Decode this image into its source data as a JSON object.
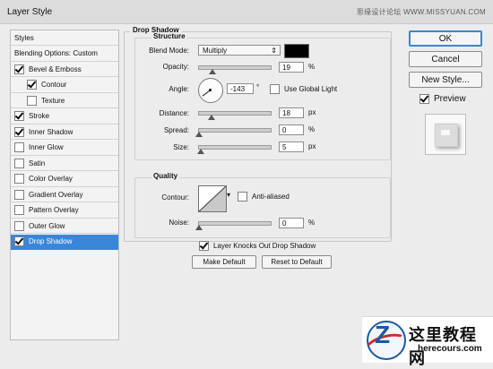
{
  "window": {
    "title": "Layer Style",
    "watermark": "思缘设计论坛 WWW.MISSYUAN.COM"
  },
  "left_panel": {
    "items": [
      {
        "label": "Styles",
        "checkbox": false,
        "checked": false,
        "indent": 0,
        "selected": false
      },
      {
        "label": "Blending Options: Custom",
        "checkbox": false,
        "checked": false,
        "indent": 0,
        "selected": false
      },
      {
        "label": "Bevel & Emboss",
        "checkbox": true,
        "checked": true,
        "indent": 0,
        "selected": false
      },
      {
        "label": "Contour",
        "checkbox": true,
        "checked": true,
        "indent": 1,
        "selected": false
      },
      {
        "label": "Texture",
        "checkbox": true,
        "checked": false,
        "indent": 1,
        "selected": false
      },
      {
        "label": "Stroke",
        "checkbox": true,
        "checked": true,
        "indent": 0,
        "selected": false
      },
      {
        "label": "Inner Shadow",
        "checkbox": true,
        "checked": true,
        "indent": 0,
        "selected": false
      },
      {
        "label": "Inner Glow",
        "checkbox": true,
        "checked": false,
        "indent": 0,
        "selected": false
      },
      {
        "label": "Satin",
        "checkbox": true,
        "checked": false,
        "indent": 0,
        "selected": false
      },
      {
        "label": "Color Overlay",
        "checkbox": true,
        "checked": false,
        "indent": 0,
        "selected": false
      },
      {
        "label": "Gradient Overlay",
        "checkbox": true,
        "checked": false,
        "indent": 0,
        "selected": false
      },
      {
        "label": "Pattern Overlay",
        "checkbox": true,
        "checked": false,
        "indent": 0,
        "selected": false
      },
      {
        "label": "Outer Glow",
        "checkbox": true,
        "checked": false,
        "indent": 0,
        "selected": false
      },
      {
        "label": "Drop Shadow",
        "checkbox": true,
        "checked": true,
        "indent": 0,
        "selected": true
      }
    ]
  },
  "drop_shadow": {
    "legend": "Drop Shadow",
    "structure": {
      "title": "Structure",
      "blend_mode_label": "Blend Mode:",
      "blend_mode_value": "Multiply",
      "color": "#000000",
      "opacity_label": "Opacity:",
      "opacity_value": "19",
      "opacity_unit": "%",
      "opacity_fraction": 0.19,
      "angle_label": "Angle:",
      "angle_value": "-143",
      "angle_unit": "°",
      "use_global_light_label": "Use Global Light",
      "use_global_light_checked": false,
      "distance_label": "Distance:",
      "distance_value": "18",
      "distance_unit": "px",
      "distance_fraction": 0.18,
      "spread_label": "Spread:",
      "spread_value": "0",
      "spread_unit": "%",
      "spread_fraction": 0.0,
      "size_label": "Size:",
      "size_value": "5",
      "size_unit": "px",
      "size_fraction": 0.03
    },
    "quality": {
      "title": "Quality",
      "contour_label": "Contour:",
      "anti_aliased_label": "Anti-aliased",
      "anti_aliased_checked": false,
      "noise_label": "Noise:",
      "noise_value": "0",
      "noise_unit": "%",
      "noise_fraction": 0.0
    },
    "knockout_label": "Layer Knocks Out Drop Shadow",
    "knockout_checked": true,
    "make_default_label": "Make Default",
    "reset_default_label": "Reset to Default"
  },
  "right_panel": {
    "ok_label": "OK",
    "cancel_label": "Cancel",
    "new_style_label": "New Style...",
    "preview_label": "Preview",
    "preview_checked": true
  },
  "logo": {
    "cn_text": "这里教程网",
    "en_text": "herecours.com"
  }
}
